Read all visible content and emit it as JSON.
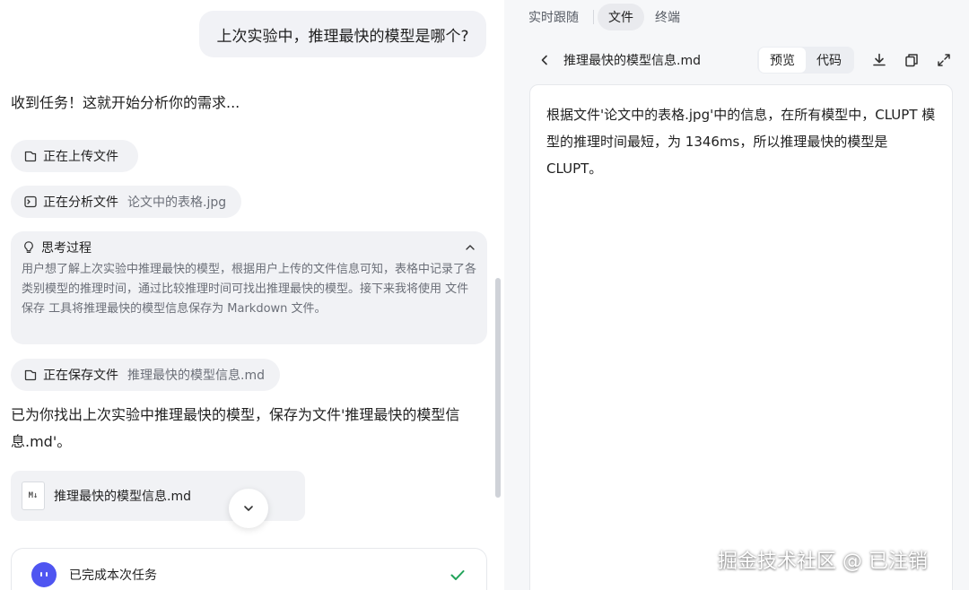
{
  "chat": {
    "user_message": "上次实验中，推理最快的模型是哪个?",
    "ack_message": "收到任务！这就开始分析你的需求...",
    "steps": {
      "upload": {
        "label": "正在上传文件"
      },
      "analyze": {
        "label": "正在分析文件",
        "file": "论文中的表格.jpg"
      },
      "save": {
        "label": "正在保存文件",
        "file": "推理最快的模型信息.md"
      }
    },
    "thinking": {
      "title": "思考过程",
      "body": "用户想了解上次实验中推理最快的模型，根据用户上传的文件信息可知，表格中记录了各类别模型的推理时间，通过比较推理时间可找出推理最快的模型。接下来我将使用 文件保存 工具将推理最快的模型信息保存为 Markdown 文件。"
    },
    "done_message": "已为你找出上次实验中推理最快的模型，保存为文件'推理最快的模型信息.md'。",
    "file_card": {
      "icon_text": "M↓",
      "name": "推理最快的模型信息.md"
    },
    "status": {
      "text": "已完成本次任务"
    }
  },
  "right_panel": {
    "tabs": [
      "实时跟随",
      "文件",
      "终端"
    ],
    "active_tab": "文件",
    "file_title": "推理最快的模型信息.md",
    "view_modes": [
      "预览",
      "代码"
    ],
    "active_view": "预览",
    "content": "根据文件'论文中的表格.jpg'中的信息，在所有模型中，CLUPT 模型的推理时间最短，为 1346ms，所以推理最快的模型是 CLUPT。"
  },
  "watermark": "掘金技术社区 @ 已注销",
  "colors": {
    "accent": "#4f55f1",
    "success": "#22a35a",
    "bubble_bg": "#f1f2f6",
    "muted_text": "#6b6f78"
  }
}
